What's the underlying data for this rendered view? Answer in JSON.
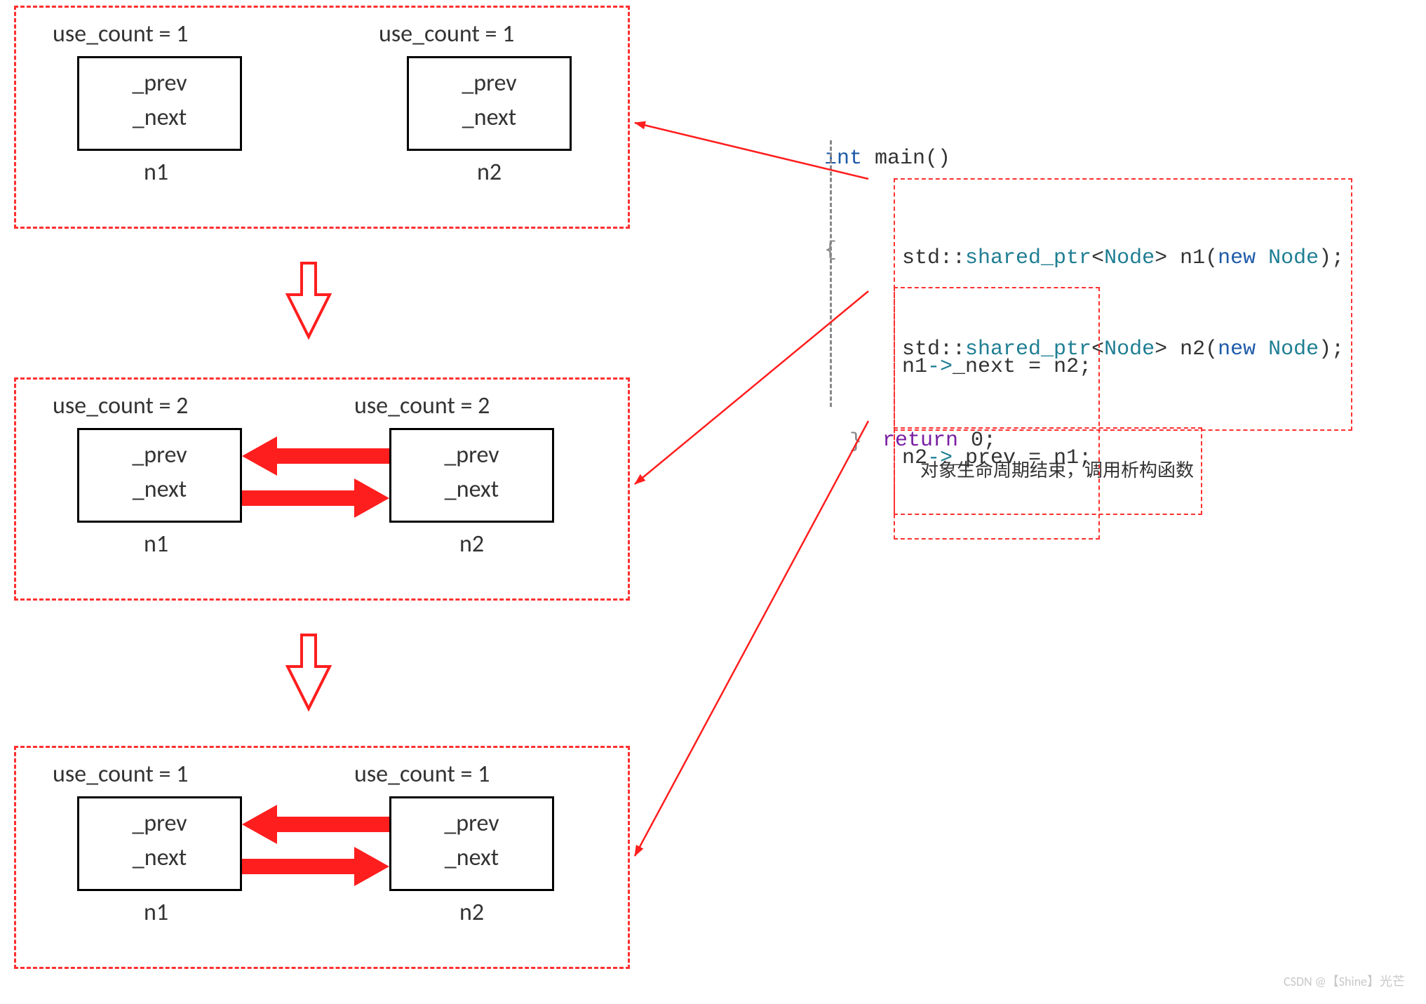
{
  "stage1": {
    "n1": {
      "count_label": "use_count = 1",
      "prev": "_prev",
      "next": "_next",
      "name": "n1"
    },
    "n2": {
      "count_label": "use_count = 1",
      "prev": "_prev",
      "next": "_next",
      "name": "n2"
    }
  },
  "stage2": {
    "n1": {
      "count_label": "use_count = 2",
      "prev": "_prev",
      "next": "_next",
      "name": "n1"
    },
    "n2": {
      "count_label": "use_count = 2",
      "prev": "_prev",
      "next": "_next",
      "name": "n2"
    }
  },
  "stage3": {
    "n1": {
      "count_label": "use_count = 1",
      "prev": "_prev",
      "next": "_next",
      "name": "n1"
    },
    "n2": {
      "count_label": "use_count = 1",
      "prev": "_prev",
      "next": "_next",
      "name": "n2"
    }
  },
  "code": {
    "fn_decl_kw": "int",
    "fn_decl_rest": " main()",
    "brace_open": "{",
    "line1": {
      "ns": "std::",
      "tmpl": "shared_ptr",
      "lt": "<",
      "type": "Node",
      "gt": ">",
      "var": " n1(",
      "new_kw": "new",
      "type2": " Node",
      "end": ");"
    },
    "line2": {
      "ns": "std::",
      "tmpl": "shared_ptr",
      "lt": "<",
      "type": "Node",
      "gt": ">",
      "var": " n2(",
      "new_kw": "new",
      "type2": " Node",
      "end": ");"
    },
    "line3": {
      "obj": "n1",
      "arrow": "->",
      "member": "_next = n2;"
    },
    "line4": {
      "obj": "n2",
      "arrow": "->",
      "member": "_prev = n1;"
    },
    "ret_kw": "return",
    "ret_rest": " 0;",
    "brace_close": "}",
    "comment": "对象生命周期结束，调用析构函数"
  },
  "watermark": "CSDN @【Shine】光芒"
}
